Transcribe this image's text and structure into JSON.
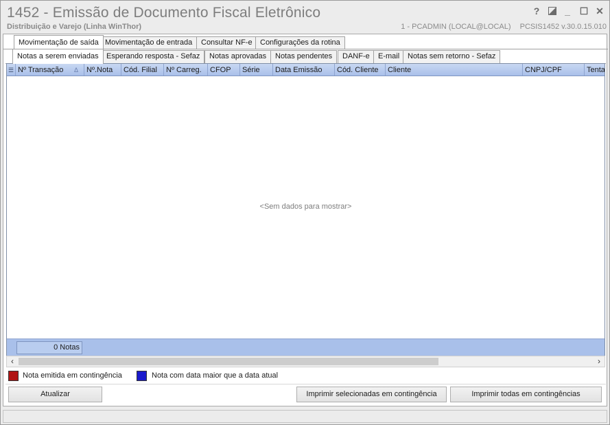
{
  "window": {
    "title": "1452 - Emissão de Documento Fiscal Eletrônico",
    "subtitle": "Distribuição e Varejo (Linha WinThor)",
    "session_user": "1 - PCADMIN (LOCAL@LOCAL)",
    "session_version": "PCSIS1452  v.30.0.15.010",
    "help_label": "?",
    "minimize_label": "_",
    "maximize_label": "☐",
    "close_label": "✕"
  },
  "main_tabs": [
    {
      "label": "Movimentação de saída",
      "active": true
    },
    {
      "label": "Movimentação de entrada",
      "active": false
    },
    {
      "label": "Consultar NF-e",
      "active": false
    },
    {
      "label": "Configurações da rotina",
      "active": false
    }
  ],
  "sub_tabs": [
    {
      "label": "Notas a serem enviadas",
      "active": true
    },
    {
      "label": "Esperando resposta - Sefaz",
      "active": false
    },
    {
      "label": "Notas aprovadas",
      "active": false
    },
    {
      "label": "Notas pendentes",
      "active": false
    },
    {
      "label": "DANF-e",
      "active": false
    },
    {
      "label": "E-mail",
      "active": false
    },
    {
      "label": "Notas sem retorno - Sefaz",
      "active": false
    }
  ],
  "grid": {
    "columns": [
      "Nº Transação",
      "Nº.Nota",
      "Cód. Filial",
      "Nº Carreg.",
      "CFOP",
      "Série",
      "Data Emissão",
      "Cód. Cliente",
      "Cliente",
      "CNPJ/CPF",
      "Tenta"
    ],
    "sort_indicator": "Δ",
    "empty_message": "<Sem dados para mostrar>",
    "footer_count": "0 Notas"
  },
  "legend": [
    {
      "label": "Nota emitida em contingência",
      "color": "#b01515"
    },
    {
      "label": "Nota com data maior que a data atual",
      "color": "#1a1acc"
    }
  ],
  "buttons": {
    "refresh": "Atualizar",
    "print_selected": "Imprimir selecionadas em contingência",
    "print_all": "Imprimir todas em contingências"
  },
  "colors": {
    "grid_header": "#a9c0ea",
    "title_text": "#7d7d7d"
  }
}
